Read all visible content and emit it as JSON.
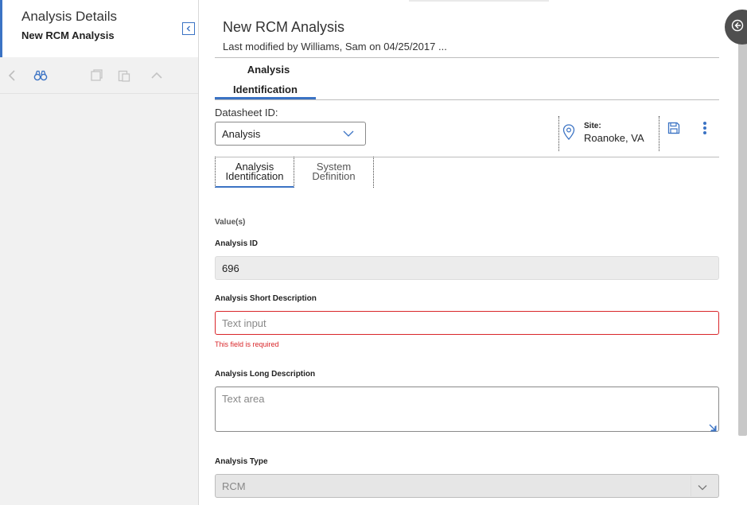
{
  "left_panel": {
    "title": "Analysis Details",
    "subtitle": "New RCM Analysis"
  },
  "header": {
    "title": "New RCM Analysis",
    "meta": "Last modified by Williams, Sam on 04/25/2017 ..."
  },
  "section_tab": {
    "line1": "Analysis",
    "line2": "Identification"
  },
  "datasheet": {
    "label": "Datasheet ID:",
    "selected": "Analysis"
  },
  "site": {
    "label": "Site:",
    "value": "Roanoke, VA"
  },
  "subtabs": [
    {
      "line1": "Analysis",
      "line2": "Identification"
    },
    {
      "line1": "System",
      "line2": "Definition"
    }
  ],
  "form": {
    "values_heading": "Value(s)",
    "analysis_id": {
      "label": "Analysis ID",
      "value": "696"
    },
    "short_desc": {
      "label": "Analysis Short Description",
      "placeholder": "Text input",
      "error": "This field is required"
    },
    "long_desc": {
      "label": "Analysis Long Description",
      "placeholder": "Text area"
    },
    "analysis_type": {
      "label": "Analysis Type",
      "value": "RCM"
    }
  },
  "colors": {
    "accent": "#3b73c4",
    "error": "#d9262a"
  }
}
